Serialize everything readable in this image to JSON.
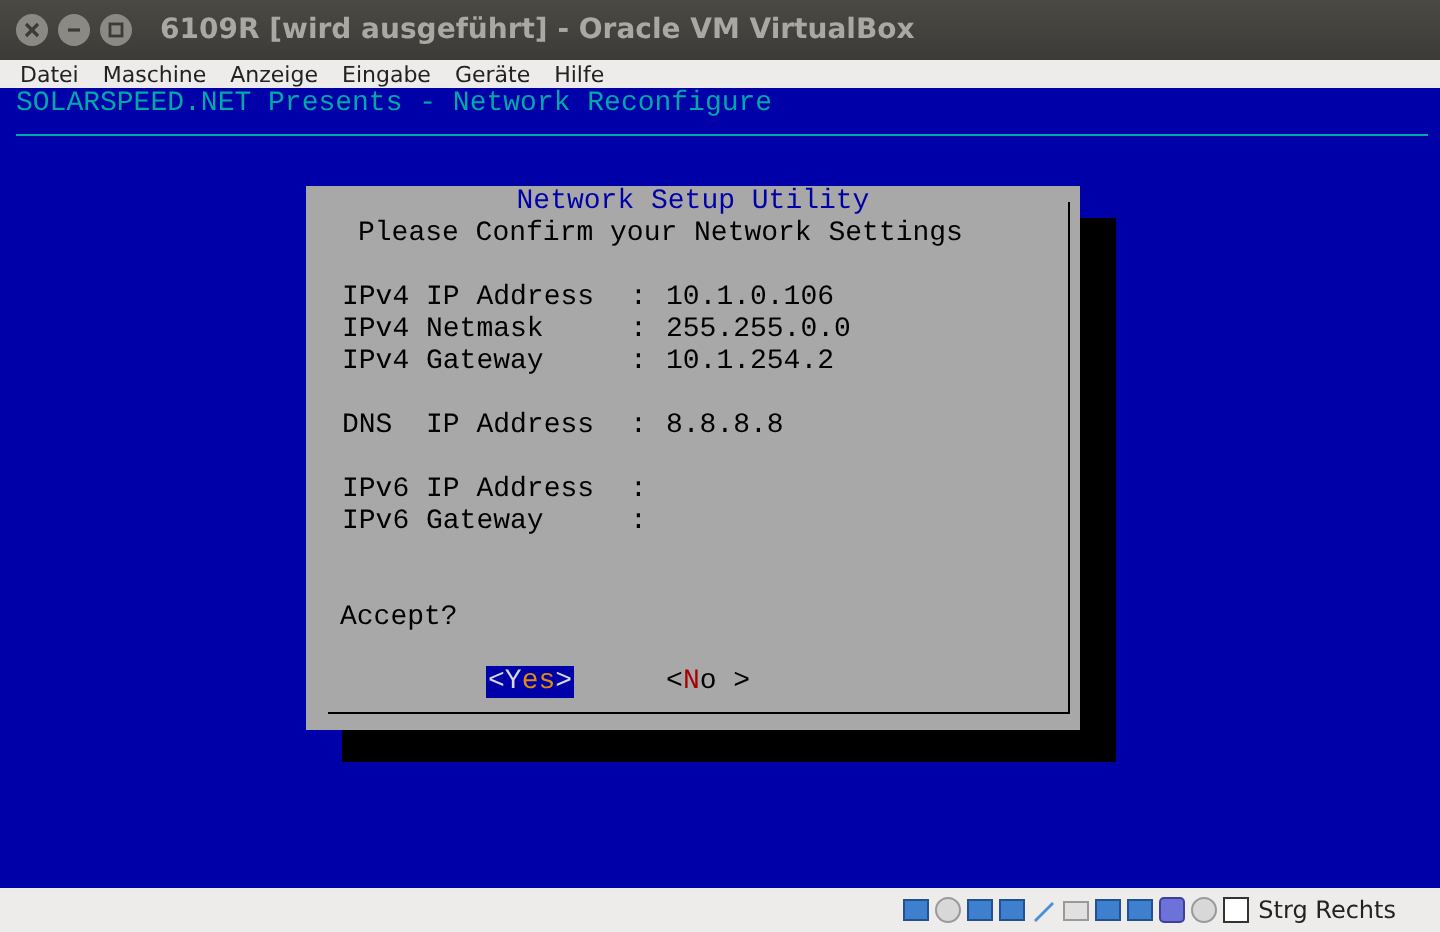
{
  "window": {
    "title": "6109R [wird ausgeführt] - Oracle VM VirtualBox"
  },
  "menu": [
    "Datei",
    "Maschine",
    "Anzeige",
    "Eingabe",
    "Geräte",
    "Hilfe"
  ],
  "console": {
    "header": "SOLARSPEED.NET Presents - Network Reconfigure",
    "dialog": {
      "title": "Network Setup Utility",
      "subtitle": "Please Confirm your Network Settings",
      "groups": [
        [
          {
            "label": "IPv4 IP Address",
            "separator": ":",
            "value": "10.1.0.106"
          },
          {
            "label": "IPv4 Netmask",
            "separator": ":",
            "value": "255.255.0.0"
          },
          {
            "label": "IPv4 Gateway",
            "separator": ":",
            "value": "10.1.254.2"
          }
        ],
        [
          {
            "label": "DNS  IP Address",
            "separator": ":",
            "value": "8.8.8.8"
          }
        ],
        [
          {
            "label": "IPv6 IP Address",
            "separator": ":"
          },
          {
            "label": "IPv6 Gateway",
            "separator": ":"
          }
        ]
      ],
      "question": "Accept?",
      "buttons": [
        {
          "open": "<",
          "hotkey": "Y",
          "rest": "es",
          "close": ">",
          "selected": true
        },
        {
          "open": "<",
          "hotkey": "N",
          "rest": "o",
          "close": ">",
          "selected": false
        }
      ]
    }
  },
  "status_bar": {
    "host_key": "Strg Rechts"
  }
}
